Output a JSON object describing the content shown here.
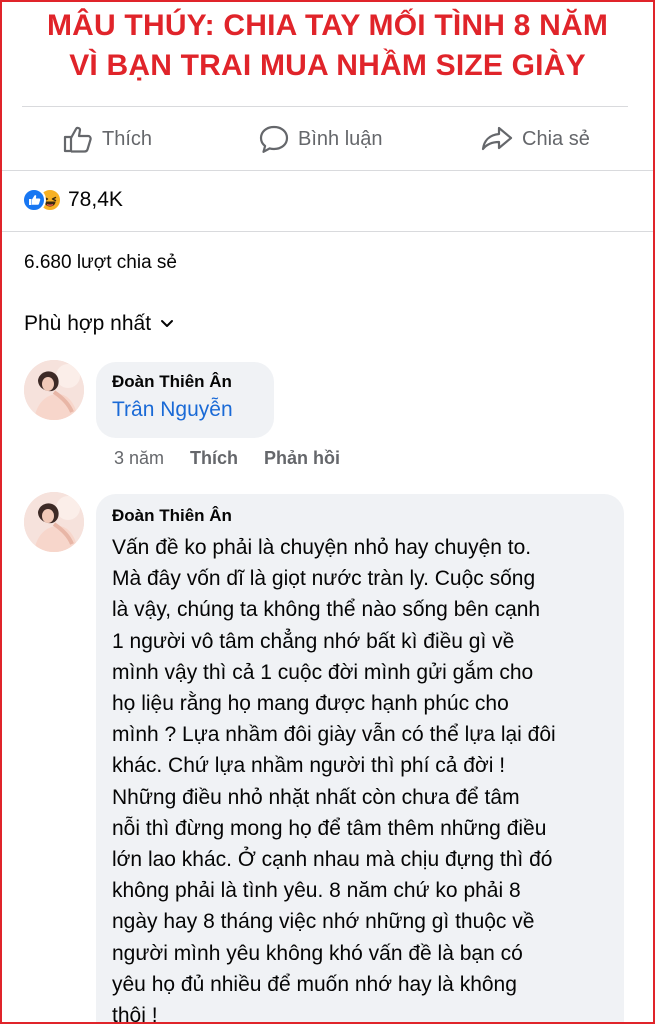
{
  "headline": {
    "line1": "MÂU THÚY: CHIA TAY MỐI TÌNH 8 NĂM",
    "line2": "VÌ BẠN TRAI MUA NHẦM SIZE GIÀY"
  },
  "actions": {
    "like": "Thích",
    "comment": "Bình luận",
    "share": "Chia sẻ"
  },
  "reactions": {
    "count": "78,4K",
    "icons": [
      "like-icon",
      "haha-icon"
    ]
  },
  "shares_text": "6.680 lượt chia sẻ",
  "sort_label": "Phù hợp nhất",
  "comments": [
    {
      "author": "Đoàn Thiên Ân",
      "mention": "Trân Nguyễn",
      "time": "3 năm",
      "like": "Thích",
      "reply": "Phản hồi"
    },
    {
      "author": "Đoàn Thiên Ân",
      "lines": [
        "Vấn đề ko phải là chuyện nhỏ hay chuyện to.",
        "Mà đây vốn dĩ là giọt nước tràn ly. Cuộc sống",
        "là vậy, chúng ta không thể nào sống bên cạnh",
        "1 người vô tâm chẳng nhớ bất kì điều gì về",
        "mình vậy thì cả 1 cuộc đời mình gửi gắm cho",
        "họ liệu rằng họ mang được hạnh phúc cho",
        "mình ? Lựa nhầm đôi giày vẫn có thể lựa lại đôi",
        "khác. Chứ lựa nhầm người thì phí cả đời !",
        "Những điều nhỏ nhặt nhất còn chưa để tâm",
        "nỗi thì đừng mong họ để tâm thêm những điều",
        "lớn lao khác. Ở cạnh nhau mà chịu đựng thì đó",
        "không phải là tình yêu. 8 năm chứ ko phải 8",
        "ngày hay 8 tháng việc nhớ những gì thuộc về",
        "người mình yêu không khó vấn đề là bạn có",
        "yêu họ đủ nhiều để muốn nhớ hay là không",
        "thôi !"
      ]
    }
  ],
  "colors": {
    "headline": "#e0242a",
    "link": "#1a6ad6",
    "muted": "#65676b",
    "bubble": "#f0f2f5"
  }
}
